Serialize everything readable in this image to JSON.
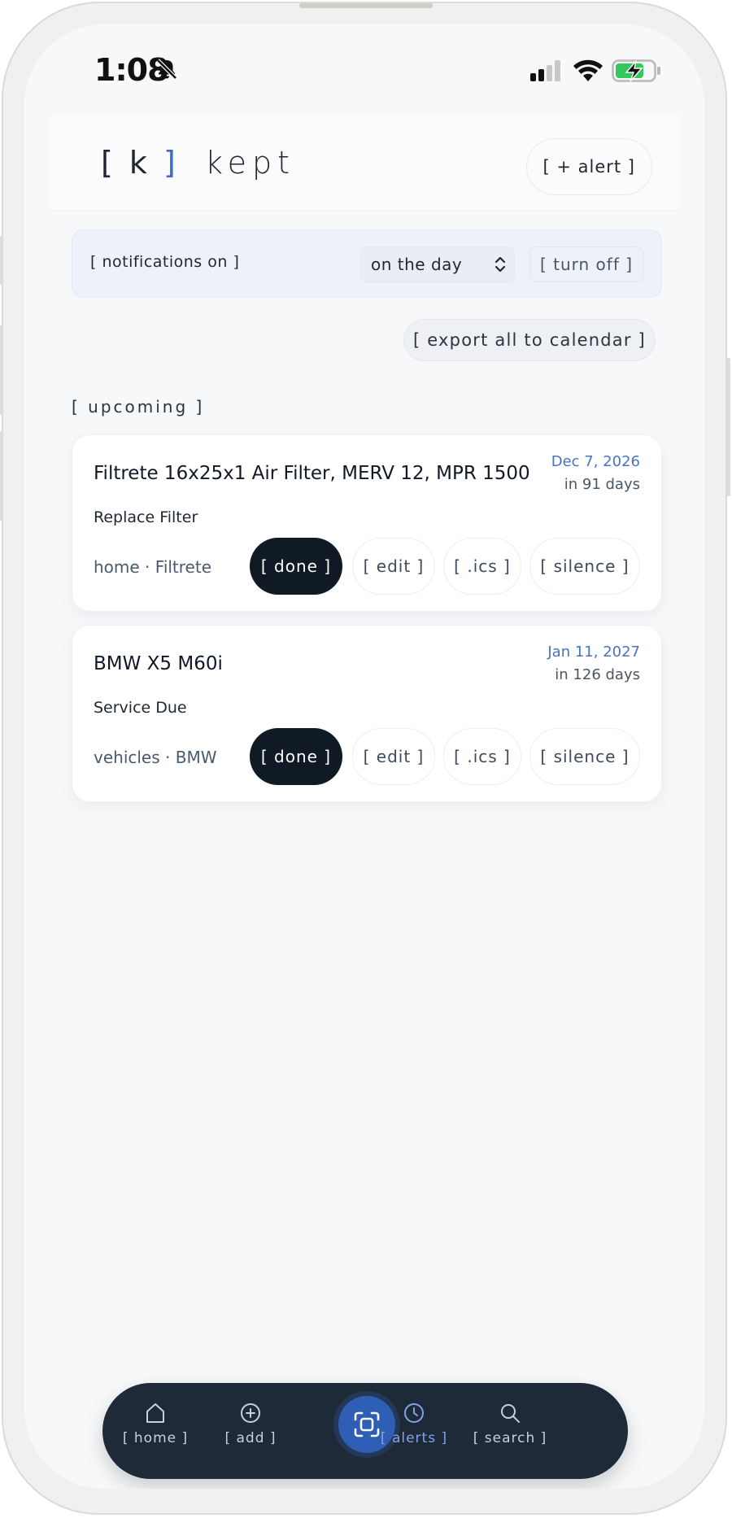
{
  "status_bar": {
    "time": "1:08",
    "icons": [
      "bell-slash-icon",
      "signal-icon",
      "wifi-icon",
      "battery-charging-icon"
    ]
  },
  "header": {
    "logo_open": "[",
    "logo_letter": "k",
    "logo_close": "]",
    "logo_word": "kept",
    "alert_button": "[ + alert ]"
  },
  "notifications": {
    "label": "[ notifications on ]",
    "timing_value": "on the day",
    "turn_off": "[ turn off ]"
  },
  "export_button": "[ export all to calendar ]",
  "section_title": "[ upcoming ]",
  "cards": [
    {
      "title": "Filtrete 16x25x1 Air Filter, MERV 12, MPR 1500",
      "date": "Dec 7, 2026",
      "relative": "in 91 days",
      "task": "Replace Filter",
      "meta": "home · Filtrete",
      "actions": {
        "done": "[ done ]",
        "edit": "[ edit ]",
        "ics": "[ .ics ]",
        "silence": "[ silence ]"
      }
    },
    {
      "title": "BMW X5 M60i",
      "date": "Jan 11, 2027",
      "relative": "in 126 days",
      "task": "Service Due",
      "meta": "vehicles · BMW",
      "actions": {
        "done": "[ done ]",
        "edit": "[ edit ]",
        "ics": "[ .ics ]",
        "silence": "[ silence ]"
      }
    }
  ],
  "bottom_nav": {
    "items": [
      {
        "label": "[ home ]",
        "icon": "home-icon"
      },
      {
        "label": "[ add ]",
        "icon": "plus-circle-icon"
      },
      {
        "label": "",
        "icon": "scan-icon"
      },
      {
        "label": "[ alerts ]",
        "icon": "clock-icon"
      },
      {
        "label": "[ search ]",
        "icon": "search-icon"
      }
    ],
    "active": "alerts"
  },
  "colors": {
    "accent": "#2f5fb4",
    "date_blue": "#4a73bd",
    "dark_button": "#0f1a24",
    "nav_bg": "#1f2a38",
    "active_nav": "#7fa3e8"
  }
}
